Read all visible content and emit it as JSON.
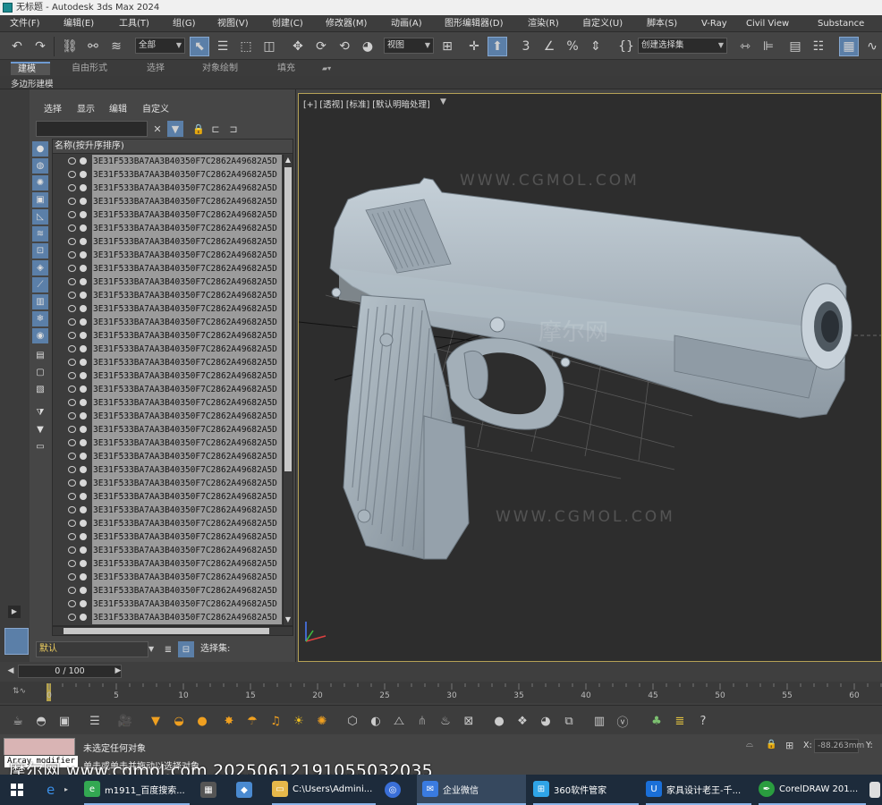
{
  "window": {
    "title": "无标题 - Autodesk 3ds Max 2024"
  },
  "menu": [
    "文件(F)",
    "编辑(E)",
    "工具(T)",
    "组(G)",
    "视图(V)",
    "创建(C)",
    "修改器(M)",
    "动画(A)",
    "图形编辑器(D)",
    "渲染(R)",
    "自定义(U)",
    "脚本(S)",
    "V-Ray",
    "Civil View",
    "Substance"
  ],
  "toolbar": {
    "selection_filter": "全部",
    "ref_coord": "视图",
    "named_selection": "创建选择集"
  },
  "ribbon": {
    "tabs": [
      "建模",
      "自由形式",
      "选择",
      "对象绘制",
      "填充"
    ],
    "active_tab": "建模",
    "sub_label": "多边形建模"
  },
  "scene_explorer": {
    "menu": [
      "选择",
      "显示",
      "编辑",
      "自定义"
    ],
    "column_header": "名称(按升序排序)",
    "row_name": "3E31F533BA7AA3B40350F7C2862A49682A5D",
    "row_count": 35,
    "layer": "默认",
    "selection_set_label": "选择集:"
  },
  "viewport": {
    "label": "[+] [透视] [标准] [默认明暗处理]",
    "watermarks": [
      "WWW.CGMOL.COM",
      "摩尔网",
      "WWW.CGMOL.COM"
    ],
    "background": "#2d2d2d",
    "model_color": "#a9b5bf"
  },
  "timeline": {
    "frame_display": "0 / 100",
    "ticks": [
      "0",
      "5",
      "10",
      "15",
      "20",
      "25",
      "30",
      "35",
      "40",
      "45",
      "50",
      "55",
      "60"
    ]
  },
  "status": {
    "maxscript_tooltip": "Array modifier",
    "line1": "未选定任何对象",
    "line2": "单击或单击并拖动以选择对象",
    "x_label": "X:",
    "x_value": "-88.263mm",
    "y_label": "Y:"
  },
  "overlay_watermark": "摩尔网 www.cgmol.com 20250612191055032035",
  "taskbar": [
    {
      "label": "m1911_百度搜索...",
      "color": "#33a852"
    },
    {
      "label": "C:\\Users\\Admini...",
      "color": "#e6b84a"
    },
    {
      "label": "企业微信",
      "color": "#3a7be0"
    },
    {
      "label": "360软件管家",
      "color": "#2fa4e7"
    },
    {
      "label": "家具设计老王-千...",
      "color": "#1a6fd8"
    },
    {
      "label": "CorelDRAW 201...",
      "color": "#2a9d3f"
    }
  ],
  "colors": {
    "accent": "#5b7fa8",
    "viewport_border": "#b5a156",
    "list_row_bg": "#9b9b9b"
  }
}
